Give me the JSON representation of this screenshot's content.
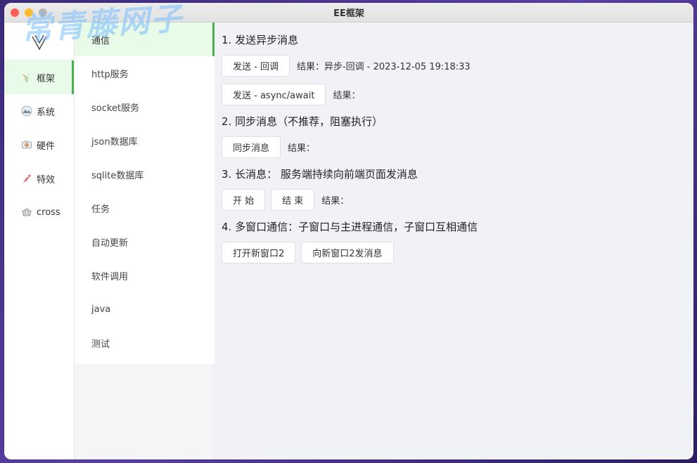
{
  "window": {
    "title": "EE框架"
  },
  "watermark": "常青藤网子",
  "sidebar1": {
    "items": [
      {
        "label": "框架",
        "icon": "windmill-icon",
        "active": true
      },
      {
        "label": "系统",
        "icon": "landscape-icon",
        "active": false
      },
      {
        "label": "硬件",
        "icon": "camera-icon",
        "active": false
      },
      {
        "label": "特效",
        "icon": "rocket-icon",
        "active": false
      },
      {
        "label": "cross",
        "icon": "basket-icon",
        "active": false
      }
    ]
  },
  "sidebar2": {
    "items": [
      {
        "label": "通信",
        "active": true
      },
      {
        "label": "http服务"
      },
      {
        "label": "socket服务"
      },
      {
        "label": "json数据库"
      },
      {
        "label": "sqlite数据库"
      },
      {
        "label": "任务"
      },
      {
        "label": "自动更新"
      },
      {
        "label": "软件调用"
      },
      {
        "label": "java"
      },
      {
        "label": "测试"
      }
    ]
  },
  "main": {
    "sections": [
      {
        "title": "1. 发送异步消息",
        "rows": [
          {
            "buttons": [
              "发送 - 回调"
            ],
            "result": "结果：异步-回调 - 2023-12-05 19:18:33"
          },
          {
            "buttons": [
              "发送 - async/await"
            ],
            "result": "结果："
          }
        ]
      },
      {
        "title": "2. 同步消息（不推荐，阻塞执行）",
        "rows": [
          {
            "buttons": [
              "同步消息"
            ],
            "result": "结果："
          }
        ]
      },
      {
        "title": "3. 长消息：  服务端持续向前端页面发消息",
        "rows": [
          {
            "buttons": [
              "开 始",
              "结 束"
            ],
            "result": "结果："
          }
        ]
      },
      {
        "title": "4. 多窗口通信：子窗口与主进程通信，子窗口互相通信",
        "rows": [
          {
            "buttons": [
              "打开新窗口2",
              "向新窗口2发消息"
            ],
            "result": ""
          }
        ]
      }
    ]
  },
  "colors": {
    "accent": "#4caf50",
    "active_bg": "#e8fae8"
  }
}
